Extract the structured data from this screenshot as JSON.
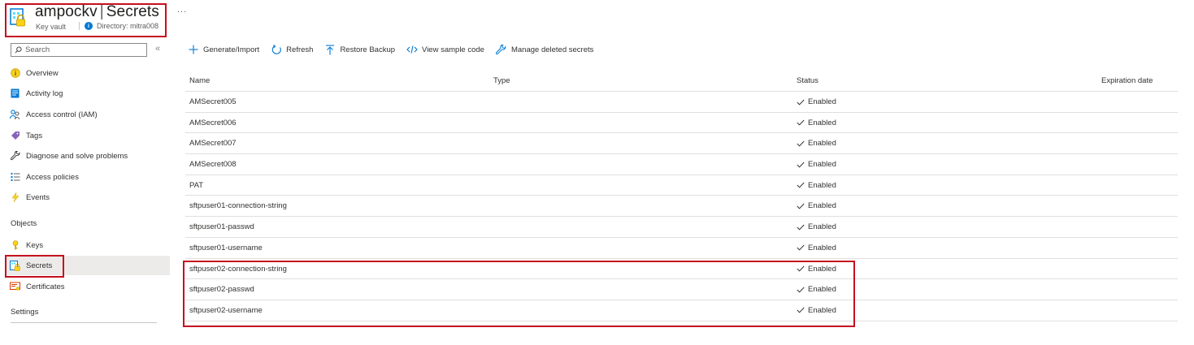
{
  "header": {
    "resource_name": "ampockv",
    "separator": "|",
    "page_name": "Secrets",
    "resource_type": "Key vault",
    "directory_label": "Directory: mitra008",
    "more_label": "..."
  },
  "sidebar": {
    "search_placeholder": "Search",
    "collapse_glyph": "«",
    "items": [
      {
        "label": "Overview",
        "icon": "overview-icon"
      },
      {
        "label": "Activity log",
        "icon": "activity-log-icon"
      },
      {
        "label": "Access control (IAM)",
        "icon": "access-control-icon"
      },
      {
        "label": "Tags",
        "icon": "tag-icon"
      },
      {
        "label": "Diagnose and solve problems",
        "icon": "wrench-icon"
      },
      {
        "label": "Access policies",
        "icon": "list-icon"
      },
      {
        "label": "Events",
        "icon": "lightning-icon"
      }
    ],
    "objects_section": "Objects",
    "object_items": [
      {
        "label": "Keys",
        "icon": "key-icon"
      },
      {
        "label": "Secrets",
        "icon": "secret-icon",
        "selected": true
      },
      {
        "label": "Certificates",
        "icon": "certificate-icon"
      }
    ],
    "settings_section": "Settings"
  },
  "toolbar": {
    "generate_import": "Generate/Import",
    "refresh": "Refresh",
    "restore_backup": "Restore Backup",
    "view_sample_code": "View sample code",
    "manage_deleted": "Manage deleted secrets"
  },
  "table": {
    "columns": {
      "name": "Name",
      "type": "Type",
      "status": "Status",
      "expiration": "Expiration date"
    },
    "rows": [
      {
        "name": "AMSecret005",
        "status": "Enabled"
      },
      {
        "name": "AMSecret006",
        "status": "Enabled"
      },
      {
        "name": "AMSecret007",
        "status": "Enabled"
      },
      {
        "name": "AMSecret008",
        "status": "Enabled"
      },
      {
        "name": "PAT",
        "status": "Enabled"
      },
      {
        "name": "sftpuser01-connection-string",
        "status": "Enabled"
      },
      {
        "name": "sftpuser01-passwd",
        "status": "Enabled"
      },
      {
        "name": "sftpuser01-username",
        "status": "Enabled"
      },
      {
        "name": "sftpuser02-connection-string",
        "status": "Enabled"
      },
      {
        "name": "sftpuser02-passwd",
        "status": "Enabled"
      },
      {
        "name": "sftpuser02-username",
        "status": "Enabled"
      }
    ]
  },
  "colors": {
    "highlight": "#c50f1f",
    "accent": "#0078d4",
    "selected_bg": "#edebe9"
  }
}
